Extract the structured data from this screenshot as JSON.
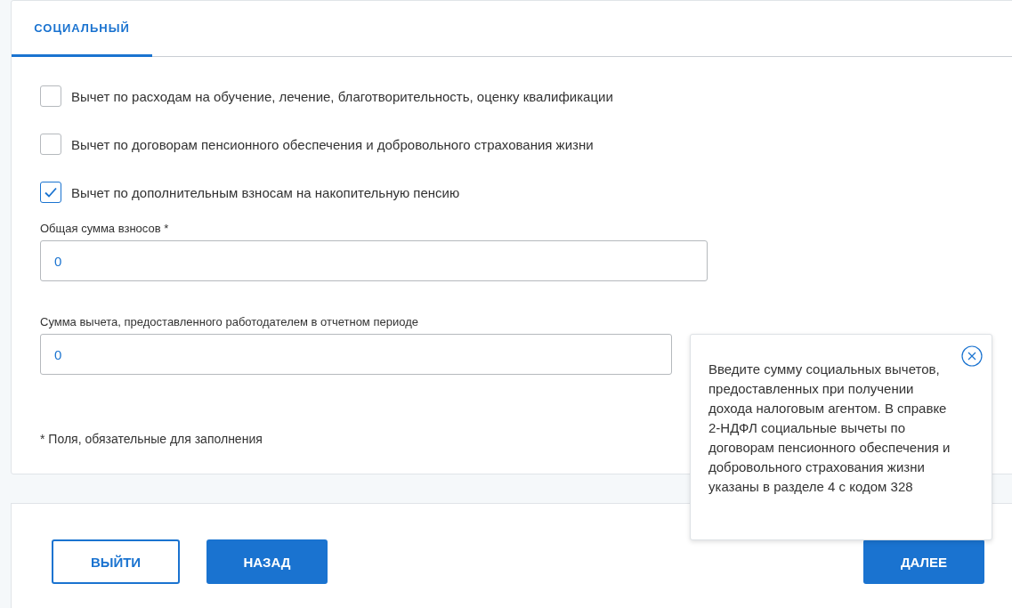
{
  "tabs": [
    {
      "label": "СОЦИАЛЬНЫЙ",
      "selected": true
    }
  ],
  "options": [
    {
      "label": "Вычет по расходам на обучение, лечение, благотворительность, оценку квалификации",
      "checked": false
    },
    {
      "label": "Вычет по договорам пенсионного обеспечения и добровольного страхования жизни",
      "checked": false
    },
    {
      "label": "Вычет по дополнительным взносам на накопительную пенсию",
      "checked": true
    }
  ],
  "fields": [
    {
      "label": "Общая сумма взносов *",
      "value": "0"
    },
    {
      "label": "Сумма вычета, предоставленного работодателем в отчетном периоде",
      "value": "0"
    }
  ],
  "required_note": "* Поля, обязательные для заполнения",
  "tooltip": {
    "text": "Введите сумму социальных вычетов, предоставленных при получении дохода налоговым агентом. В справке 2-НДФЛ социальные вычеты по договорам пенсионного обеспечения и добровольного страхования жизни указаны в разделе 4 с кодом 328"
  },
  "buttons": [
    {
      "label": "ВЫЙТИ",
      "kind": "outline"
    },
    {
      "label": "НАЗАД",
      "kind": "primary"
    },
    {
      "label": "ДАЛЕЕ",
      "kind": "primary"
    }
  ]
}
